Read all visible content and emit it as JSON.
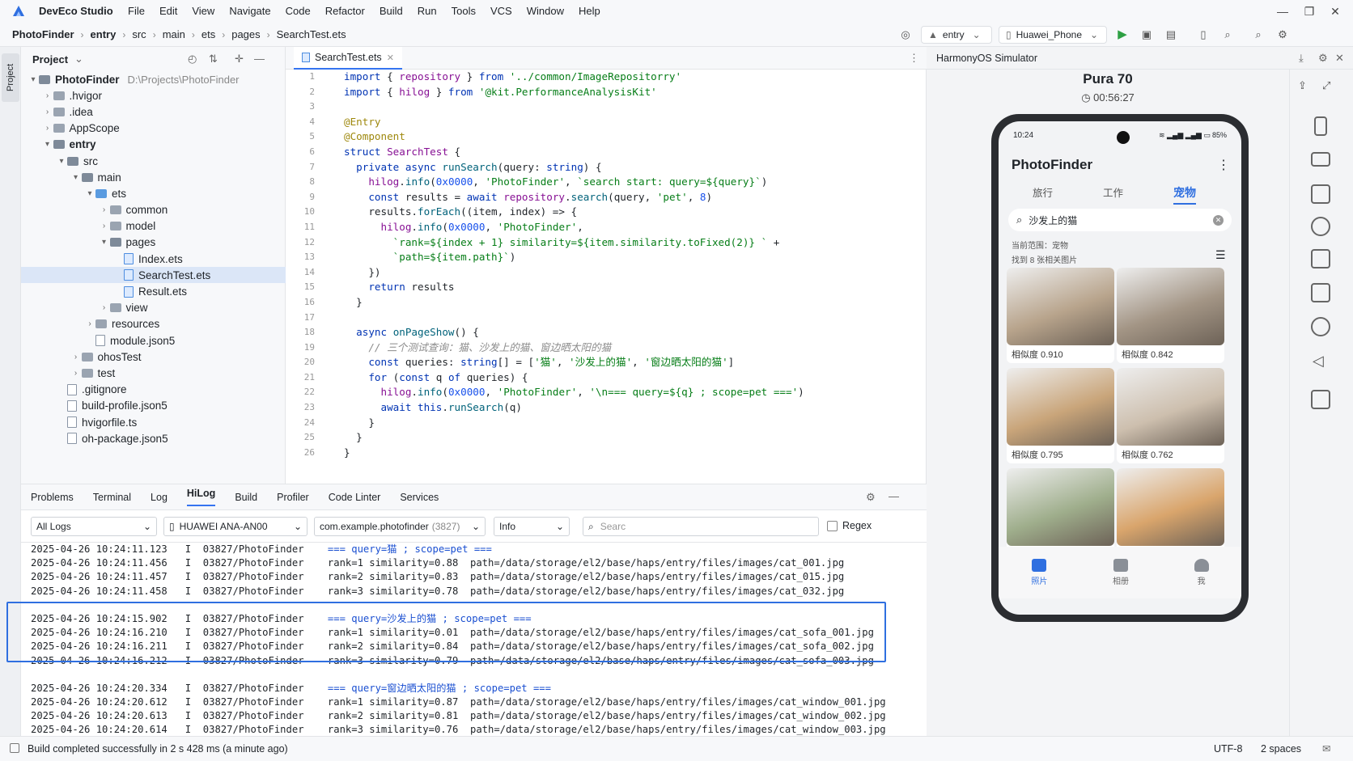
{
  "app": {
    "name": "DevEco Studio",
    "menu": [
      "File",
      "Edit",
      "View",
      "Navigate",
      "Code",
      "Refactor",
      "Build",
      "Run",
      "Tools",
      "VCS",
      "Window",
      "Help"
    ]
  },
  "breadcrumb": [
    "PhotoFinder",
    "entry",
    "src",
    "main",
    "ets",
    "pages",
    "SearchTest.ets"
  ],
  "toolbar": {
    "module": "entry",
    "device": "Huawei_Phone"
  },
  "project": {
    "title": "Project",
    "tree": [
      {
        "label": "PhotoFinder",
        "depth": 0,
        "type": "folder",
        "open": true,
        "bold": true,
        "path": "D:\\Projects\\PhotoFinder"
      },
      {
        "label": ".hvigor",
        "depth": 1,
        "type": "folder"
      },
      {
        "label": ".idea",
        "depth": 1,
        "type": "folder"
      },
      {
        "label": "AppScope",
        "depth": 1,
        "type": "folder"
      },
      {
        "label": "entry",
        "depth": 1,
        "type": "folder",
        "open": true,
        "bold": true
      },
      {
        "label": "src",
        "depth": 2,
        "type": "folder",
        "open": true
      },
      {
        "label": "main",
        "depth": 3,
        "type": "folder",
        "open": true
      },
      {
        "label": "ets",
        "depth": 4,
        "type": "folder",
        "open": true,
        "blue": true
      },
      {
        "label": "common",
        "depth": 5,
        "type": "folder"
      },
      {
        "label": "model",
        "depth": 5,
        "type": "folder"
      },
      {
        "label": "pages",
        "depth": 5,
        "type": "folder",
        "open": true
      },
      {
        "label": "Index.ets",
        "depth": 6,
        "type": "ets"
      },
      {
        "label": "SearchTest.ets",
        "depth": 6,
        "type": "ets",
        "selected": true
      },
      {
        "label": "Result.ets",
        "depth": 6,
        "type": "ets"
      },
      {
        "label": "view",
        "depth": 5,
        "type": "folder"
      },
      {
        "label": "resources",
        "depth": 4,
        "type": "folder"
      },
      {
        "label": "module.json5",
        "depth": 4,
        "type": "file"
      },
      {
        "label": "ohosTest",
        "depth": 3,
        "type": "folder"
      },
      {
        "label": "test",
        "depth": 3,
        "type": "folder"
      },
      {
        "label": ".gitignore",
        "depth": 2,
        "type": "file"
      },
      {
        "label": "build-profile.json5",
        "depth": 2,
        "type": "file"
      },
      {
        "label": "hvigorfile.ts",
        "depth": 2,
        "type": "file"
      },
      {
        "label": "oh-package.json5",
        "depth": 2,
        "type": "file"
      }
    ]
  },
  "editor": {
    "tab": "SearchTest.ets",
    "lines": [
      "import { repository } from '../common/ImageRepositorry'",
      "import { hilog } from '@kit.PerformanceAnalysisKit'",
      "",
      "@Entry",
      "@Component",
      "struct SearchTest {",
      "  private async runSearch(query: string) {",
      "    hilog.info(0x0000, 'PhotoFinder', `search start: query=${query}`)",
      "    const results = await repository.search(query, 'pet', 8)",
      "    results.forEach((item, index) => {",
      "      hilog.info(0x0000, 'PhotoFinder',",
      "        `rank=${index + 1} similarity=${item.similarity.toFixed(2)} ` +",
      "        `path=${item.path}`)",
      "    })",
      "    return results",
      "  }",
      "",
      "  async onPageShow() {",
      "    // 三个测试查询：猫、沙发上的猫、窗边晒太阳的猫",
      "    const queries: string[] = ['猫', '沙发上的猫', '窗边晒太阳的猫']",
      "    for (const q of queries) {",
      "      hilog.info(0x0000, 'PhotoFinder', '\\n=== query=${q} ; scope=pet ===')",
      "      await this.runSearch(q)",
      "    }",
      "  }",
      "}"
    ]
  },
  "bottom": {
    "tabs": [
      "Problems",
      "Terminal",
      "Log",
      "HiLog",
      "Build",
      "Profiler",
      "Code Linter",
      "Services"
    ],
    "active": "HiLog",
    "filters": {
      "level_scope": "All Logs",
      "device": "HUAWEI ANA-AN00",
      "process": "com.example.photofinder",
      "pid": "(3827)",
      "level": "Info",
      "search_placeholder": "Searc",
      "regex": "Regex"
    },
    "logs": [
      [
        {
          "time": "2025-04-26 10:24:11.123",
          "tag": "I  03827/PhotoFinder",
          "msg": "=== query=猫 ; scope=pet ===",
          "q": true
        },
        {
          "time": "2025-04-26 10:24:11.456",
          "tag": "I  03827/PhotoFinder",
          "msg": "rank=1 similarity=0.88  path=/data/storage/el2/base/haps/entry/files/images/cat_001.jpg"
        },
        {
          "time": "2025-04-26 10:24:11.457",
          "tag": "I  03827/PhotoFinder",
          "msg": "rank=2 similarity=0.83  path=/data/storage/el2/base/haps/entry/files/images/cat_015.jpg"
        },
        {
          "time": "2025-04-26 10:24:11.458",
          "tag": "I  03827/PhotoFinder",
          "msg": "rank=3 similarity=0.78  path=/data/storage/el2/base/haps/entry/files/images/cat_032.jpg"
        }
      ],
      [
        {
          "time": "2025-04-26 10:24:15.902",
          "tag": "I  03827/PhotoFinder",
          "msg": "=== query=沙发上的猫 ; scope=pet ===",
          "q": true
        },
        {
          "time": "2025-04-26 10:24:16.210",
          "tag": "I  03827/PhotoFinder",
          "msg": "rank=1 similarity=0.01  path=/data/storage/el2/base/haps/entry/files/images/cat_sofa_001.jpg"
        },
        {
          "time": "2025-04-26 10:24:16.211",
          "tag": "I  03827/PhotoFinder",
          "msg": "rank=2 similarity=0.84  path=/data/storage/el2/base/haps/entry/files/images/cat_sofa_002.jpg"
        },
        {
          "time": "2025-04-26 10:24:16.212",
          "tag": "I  03827/PhotoFinder",
          "msg": "rank=3 similarity=0.79  path=/data/storage/el2/base/haps/entry/files/images/cat_sofa_003.jpg"
        }
      ],
      [
        {
          "time": "2025-04-26 10:24:20.334",
          "tag": "I  03827/PhotoFinder",
          "msg": "=== query=窗边晒太阳的猫 ; scope=pet ===",
          "q": true
        },
        {
          "time": "2025-04-26 10:24:20.612",
          "tag": "I  03827/PhotoFinder",
          "msg": "rank=1 similarity=0.87  path=/data/storage/el2/base/haps/entry/files/images/cat_window_001.jpg"
        },
        {
          "time": "2025-04-26 10:24:20.613",
          "tag": "I  03827/PhotoFinder",
          "msg": "rank=2 similarity=0.81  path=/data/storage/el2/base/haps/entry/files/images/cat_window_002.jpg"
        },
        {
          "time": "2025-04-26 10:24:20.614",
          "tag": "I  03827/PhotoFinder",
          "msg": "rank=3 similarity=0.76  path=/data/storage/el2/base/haps/entry/files/images/cat_window_003.jpg"
        }
      ]
    ]
  },
  "simulator": {
    "title": "HarmonyOS Simulator",
    "device": "Pura 70",
    "time": "00:56:27",
    "phone": {
      "status_time": "10:24",
      "battery": "85%",
      "app_title": "PhotoFinder",
      "tabs": [
        "旅行",
        "工作",
        "宠物"
      ],
      "active_tab": "宠物",
      "search_value": "沙发上的猫",
      "scope_text": "当前范围：宠物",
      "found_text": "找到 8 张相关图片",
      "results": [
        {
          "label": "相似度 0.910",
          "color": "#b8a48c"
        },
        {
          "label": "相似度 0.842",
          "color": "#a39585"
        },
        {
          "label": "相似度 0.795",
          "color": "#c9a57a"
        },
        {
          "label": "相似度 0.762",
          "color": "#cdbfae"
        },
        {
          "label": "",
          "color": "#9fae8c"
        },
        {
          "label": "",
          "color": "#d9a56c"
        }
      ],
      "nav": [
        "照片",
        "相册",
        "我"
      ]
    }
  },
  "status": {
    "message": "Build completed successfully in 2 s 428 ms (a minute ago)",
    "encoding": "UTF-8",
    "indent": "2 spaces"
  }
}
